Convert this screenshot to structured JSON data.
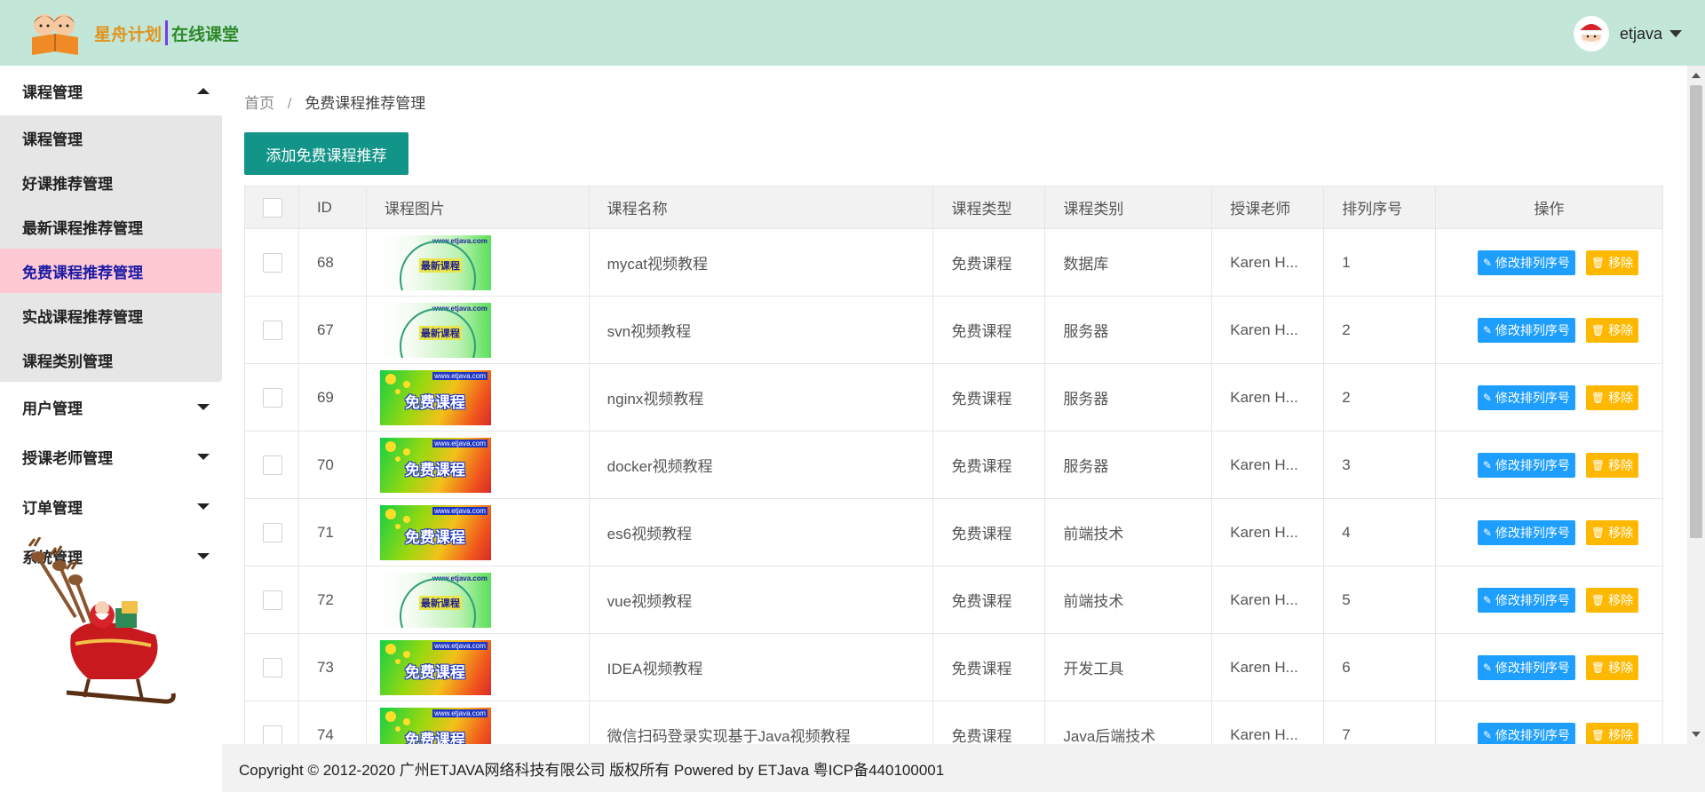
{
  "header": {
    "logo_text_a": "星舟计划",
    "logo_text_b": "在线课堂",
    "username": "etjava"
  },
  "sidebar": {
    "groups": [
      {
        "label": "课程管理",
        "expanded": true
      },
      {
        "label": "用户管理",
        "expanded": false
      },
      {
        "label": "授课老师管理",
        "expanded": false
      },
      {
        "label": "订单管理",
        "expanded": false
      },
      {
        "label": "系统管理",
        "expanded": false
      }
    ],
    "course_items": [
      {
        "label": "课程管理"
      },
      {
        "label": "好课推荐管理"
      },
      {
        "label": "最新课程推荐管理"
      },
      {
        "label": "免费课程推荐管理",
        "active": true
      },
      {
        "label": "实战课程推荐管理"
      },
      {
        "label": "课程类别管理"
      }
    ]
  },
  "breadcrumb": {
    "home": "首页",
    "separator": "/",
    "current": "免费课程推荐管理"
  },
  "toolbar": {
    "add_label": "添加免费课程推荐"
  },
  "table": {
    "columns": [
      "ID",
      "课程图片",
      "课程名称",
      "课程类型",
      "课程类别",
      "授课老师",
      "排列序号",
      "操作"
    ],
    "edit_label": "修改排列序号",
    "remove_label": "移除",
    "rows": [
      {
        "id": "68",
        "img": "green",
        "name": "mycat视频教程",
        "type": "免费课程",
        "category": "数据库",
        "teacher": "Karen H...",
        "order": "1"
      },
      {
        "id": "67",
        "img": "green",
        "name": "svn视频教程",
        "type": "免费课程",
        "category": "服务器",
        "teacher": "Karen H...",
        "order": "2"
      },
      {
        "id": "69",
        "img": "rainbow",
        "name": "nginx视频教程",
        "type": "免费课程",
        "category": "服务器",
        "teacher": "Karen H...",
        "order": "2"
      },
      {
        "id": "70",
        "img": "rainbow",
        "name": "docker视频教程",
        "type": "免费课程",
        "category": "服务器",
        "teacher": "Karen H...",
        "order": "3"
      },
      {
        "id": "71",
        "img": "rainbow",
        "name": "es6视频教程",
        "type": "免费课程",
        "category": "前端技术",
        "teacher": "Karen H...",
        "order": "4"
      },
      {
        "id": "72",
        "img": "green",
        "name": "vue视频教程",
        "type": "免费课程",
        "category": "前端技术",
        "teacher": "Karen H...",
        "order": "5"
      },
      {
        "id": "73",
        "img": "rainbow",
        "name": "IDEA视频教程",
        "type": "免费课程",
        "category": "开发工具",
        "teacher": "Karen H...",
        "order": "6"
      },
      {
        "id": "74",
        "img": "rainbow",
        "name": "微信扫码登录实现基于Java视频教程",
        "type": "免费课程",
        "category": "Java后端技术",
        "teacher": "Karen H...",
        "order": "7"
      }
    ],
    "image_text": {
      "green_label": "最新课程",
      "rainbow_label": "免费课程",
      "url": "www.etjava.com"
    }
  },
  "footer": {
    "text": "Copyright © 2012-2020 广州ETJAVA网络科技有限公司 版权所有 Powered by ETJava 粤ICP备440100001"
  },
  "colors": {
    "header_bg": "#c2e6d8",
    "primary_teal": "#139488",
    "active_menu_bg": "#ffc9d4",
    "edit_blue": "#1e9fff",
    "remove_yellow": "#ffb800"
  }
}
